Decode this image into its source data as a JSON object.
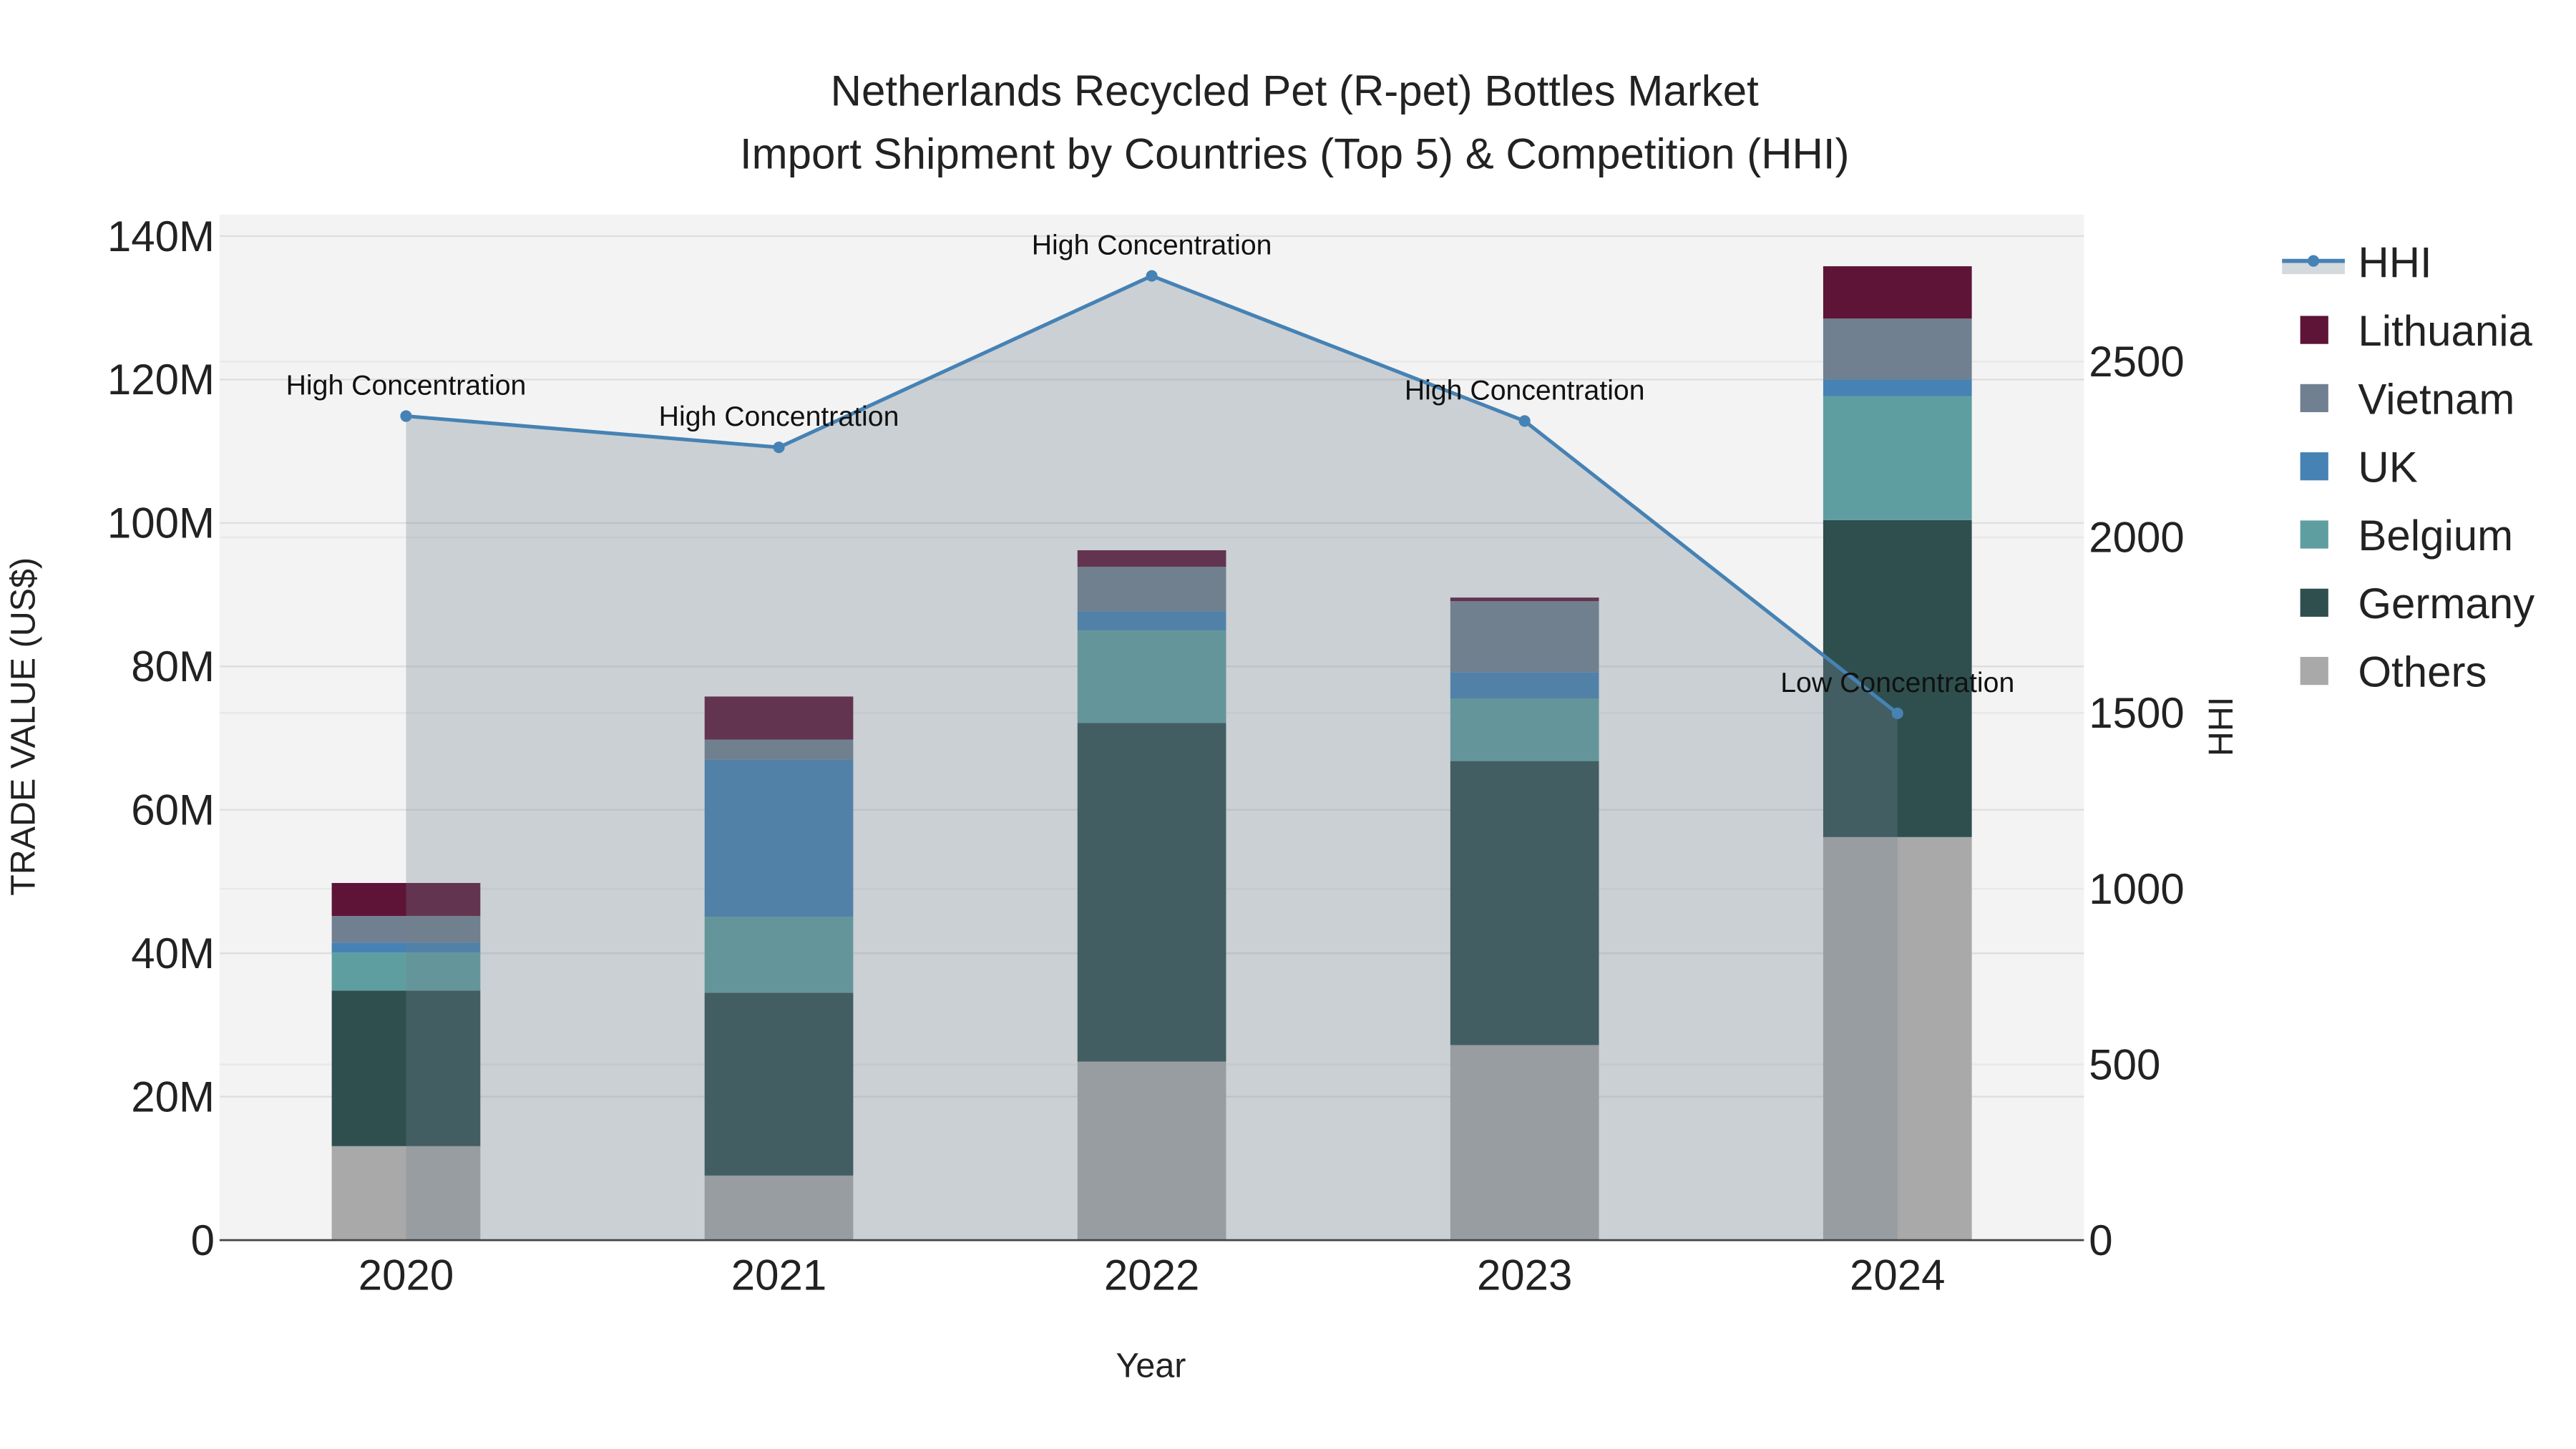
{
  "chart_data": {
    "type": "bar",
    "stacked": true,
    "title_line1": "Netherlands Recycled Pet (R-pet) Bottles Market",
    "title_line2": "Import Shipment by Countries (Top 5) & Competition (HHI)",
    "xlabel": "Year",
    "ylabel": "TRADE VALUE (US$)",
    "y2label": "HHI",
    "categories": [
      "2020",
      "2021",
      "2022",
      "2023",
      "2024"
    ],
    "ylim": [
      0,
      140
    ],
    "y_unit": "M",
    "y_ticks": [
      0,
      20,
      40,
      60,
      80,
      100,
      120,
      140
    ],
    "y_tick_labels": [
      "0",
      "20M",
      "40M",
      "60M",
      "80M",
      "100M",
      "120M",
      "140M"
    ],
    "y2lim": [
      0,
      2870
    ],
    "y2_ticks": [
      0,
      500,
      1000,
      1500,
      2000,
      2500
    ],
    "y2_tick_labels": [
      "0",
      "500",
      "1000",
      "1500",
      "2000",
      "2500"
    ],
    "grid": true,
    "legend_position": "right",
    "series": [
      {
        "name": "Others",
        "color": "#a9a9a9",
        "values": [
          13.1,
          9.0,
          24.9,
          27.2,
          56.2
        ]
      },
      {
        "name": "Germany",
        "color": "#2f4f4f",
        "values": [
          21.7,
          25.5,
          47.2,
          39.6,
          44.2
        ]
      },
      {
        "name": "Belgium",
        "color": "#5f9ea0",
        "values": [
          5.3,
          10.6,
          12.9,
          8.7,
          17.3
        ]
      },
      {
        "name": "UK",
        "color": "#4682b4",
        "values": [
          1.4,
          21.9,
          2.7,
          3.7,
          2.3
        ]
      },
      {
        "name": "Vietnam",
        "color": "#708090",
        "values": [
          3.7,
          2.8,
          6.2,
          9.9,
          8.5
        ]
      },
      {
        "name": "Lithuania",
        "color": "#5e1436",
        "values": [
          4.6,
          6.0,
          2.3,
          0.5,
          7.3
        ]
      }
    ],
    "hhi": {
      "name": "HHI",
      "color": "#4682b4",
      "values": [
        2345,
        2256,
        2744,
        2331,
        1499
      ],
      "annotations": [
        "High Concentration",
        "High Concentration",
        "High Concentration",
        "High Concentration",
        "Low Concentration"
      ]
    },
    "legend_order": [
      "HHI",
      "Lithuania",
      "Vietnam",
      "UK",
      "Belgium",
      "Germany",
      "Others"
    ]
  }
}
